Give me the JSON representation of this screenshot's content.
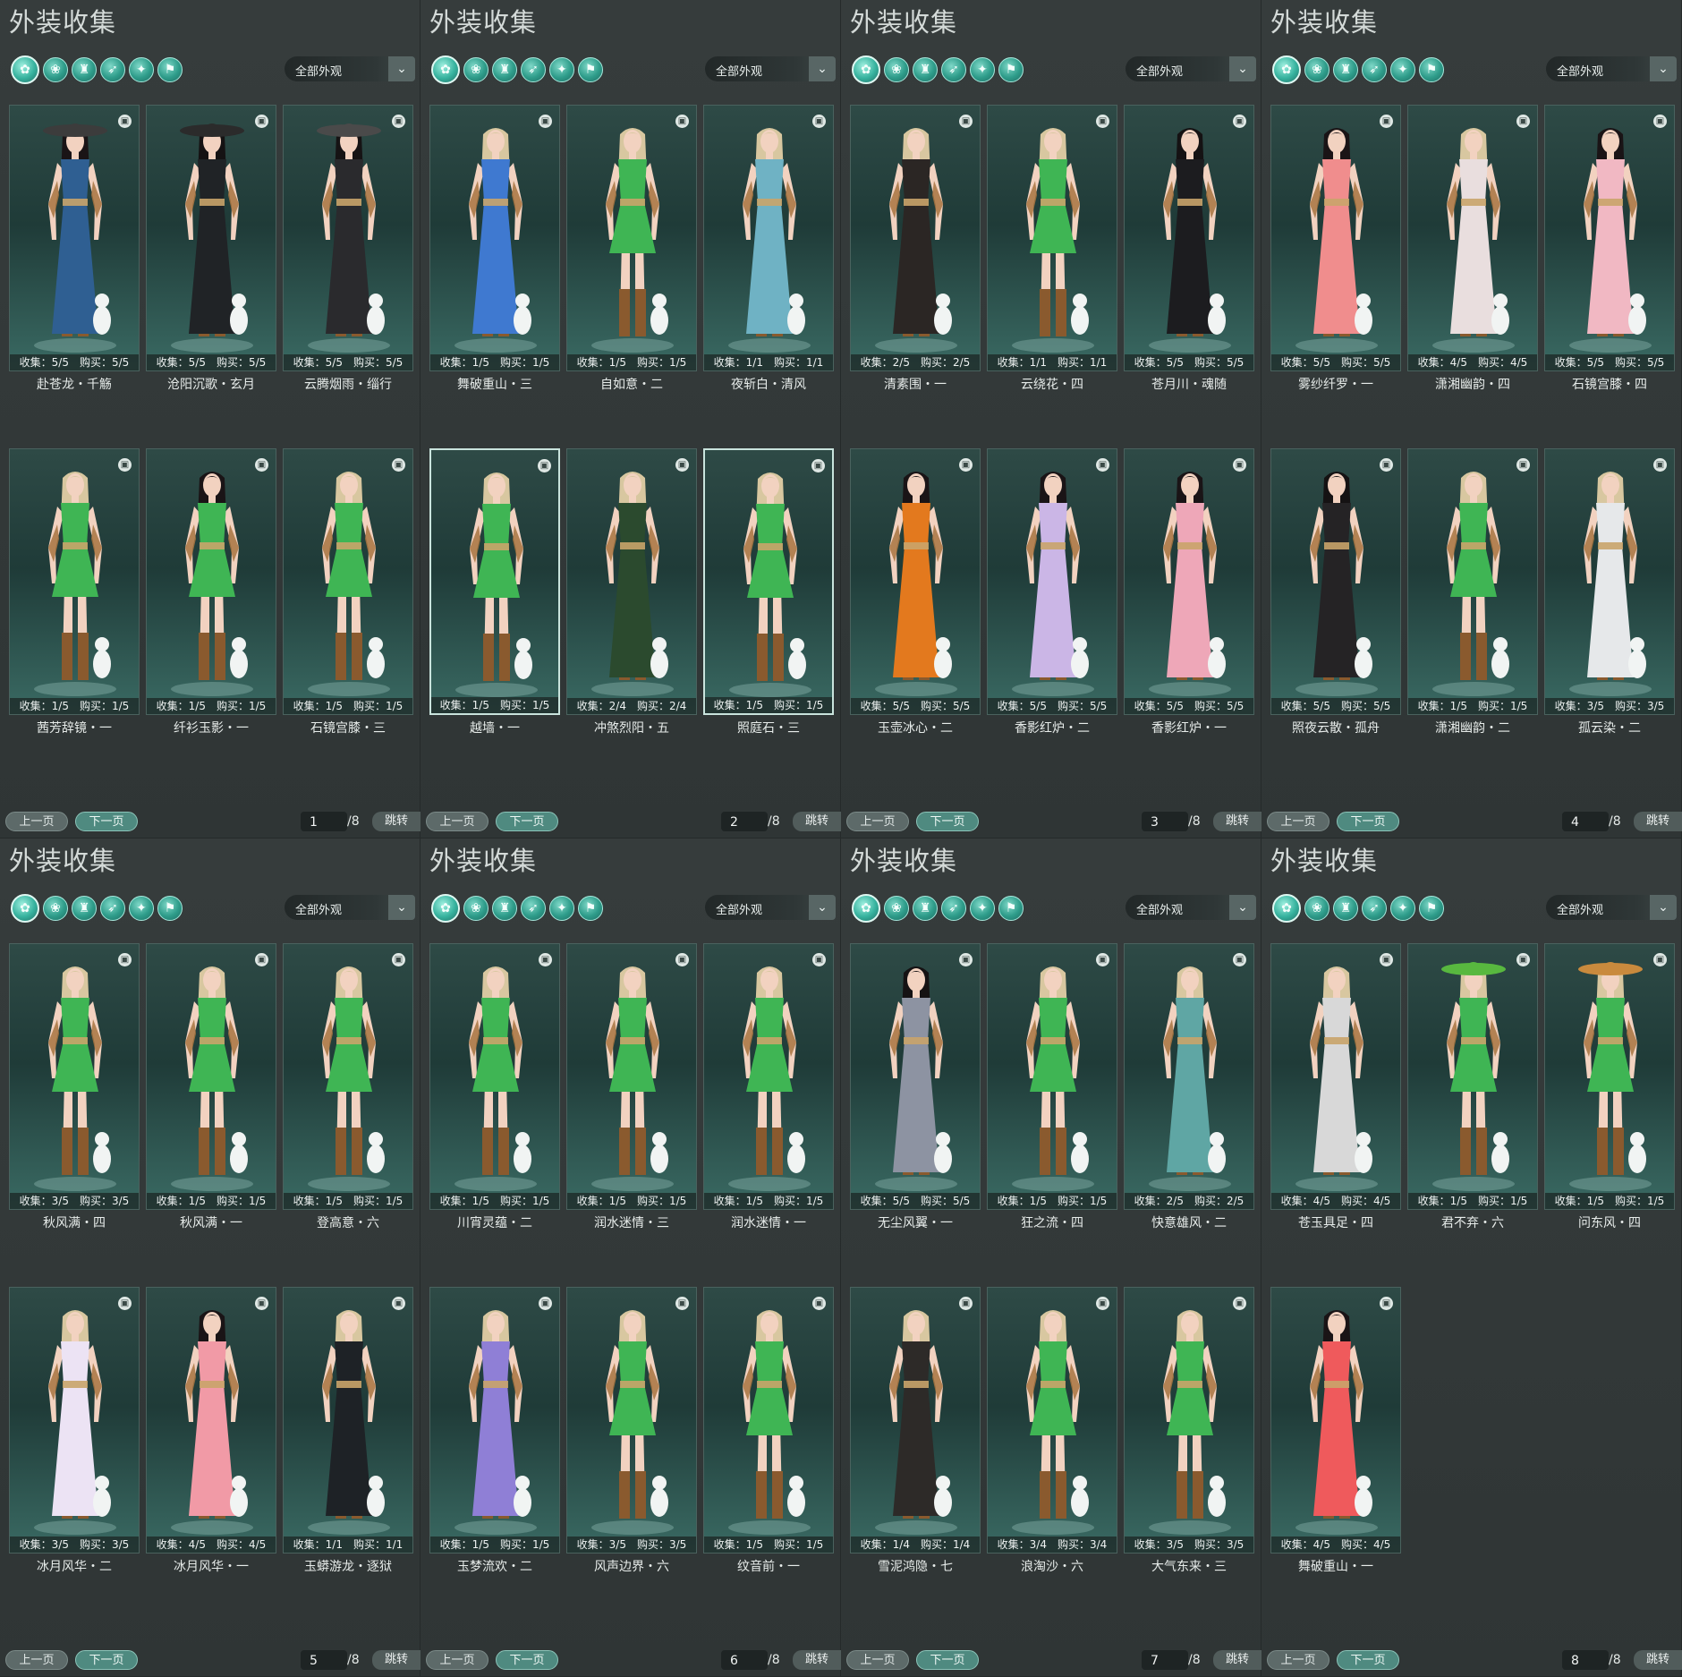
{
  "colors": {
    "background": "#2e3434",
    "card_gradient_top": "#2e4a46",
    "card_gradient_bottom": "#3a6a63",
    "accent_teal": "#2e9c8a",
    "dress_green": "#3fb554"
  },
  "category_icons": [
    "outfit-all-icon",
    "headwear-icon",
    "top-icon",
    "cape-icon",
    "mask-icon",
    "boots-icon"
  ],
  "panels": [
    {
      "title": "外装收集",
      "filter_label": "全部外观",
      "pager": {
        "prev_label": "上一页",
        "next_label": "下一页",
        "current_page": "1",
        "total_label": "/8",
        "jump_label": "跳转"
      },
      "items": [
        {
          "name": "赴苍龙・千觞",
          "stats": "收集：5/5　购买：5/5",
          "outfit": "#2f5f92",
          "hair": "#1a1416",
          "hat": "#3c3c3c"
        },
        {
          "name": "沧阳沉歌・玄月",
          "stats": "收集：5/5　购买：5/5",
          "outfit": "#202326",
          "hair": "#151213",
          "hat": "#2b2b2b"
        },
        {
          "name": "云腾烟雨・缁行",
          "stats": "收集：5/5　购买：5/5",
          "outfit": "#2a2a2d",
          "hair": "#161314",
          "hat": "#4a4a4a"
        },
        {
          "name": "茜芳辞镜・一",
          "stats": "收集：1/5　购买：1/5",
          "outfit": "#3fb554",
          "hair": "#d8c7a0"
        },
        {
          "name": "纤衫玉影・一",
          "stats": "收集：1/5　购买：1/5",
          "outfit": "#3fb554",
          "hair": "#1a1416"
        },
        {
          "name": "石镜宫膝・三",
          "stats": "收集：1/5　购买：1/5",
          "outfit": "#3fb554",
          "hair": "#d8c7a0"
        }
      ]
    },
    {
      "title": "外装收集",
      "filter_label": "全部外观",
      "pager": {
        "prev_label": "上一页",
        "next_label": "下一页",
        "current_page": "2",
        "total_label": "/8",
        "jump_label": "跳转"
      },
      "items": [
        {
          "name": "舞破重山・三",
          "stats": "收集：1/5　购买：1/5",
          "outfit": "#3f79d0",
          "hair": "#d8c7a0"
        },
        {
          "name": "自如意・二",
          "stats": "收集：1/5　购买：1/5",
          "outfit": "#3fb554",
          "hair": "#d8c7a0"
        },
        {
          "name": "夜斩白・清风",
          "stats": "收集：1/1　购买：1/1",
          "outfit": "#6fb2c4",
          "hair": "#d8c7a0"
        },
        {
          "name": "越墙・一",
          "stats": "收集：1/5　购买：1/5",
          "outfit": "#3fb554",
          "hair": "#d8c7a0",
          "selected": true
        },
        {
          "name": "冲煞烈阳・五",
          "stats": "收集：2/4　购买：2/4",
          "outfit": "#2b4a2e",
          "hair": "#d8c7a0"
        },
        {
          "name": "照庭石・三",
          "stats": "收集：1/5　购买：1/5",
          "outfit": "#3fb554",
          "hair": "#d8c7a0",
          "selected": true
        }
      ]
    },
    {
      "title": "外装收集",
      "filter_label": "全部外观",
      "pager": {
        "prev_label": "上一页",
        "next_label": "下一页",
        "current_page": "3",
        "total_label": "/8",
        "jump_label": "跳转"
      },
      "items": [
        {
          "name": "清素围・一",
          "stats": "收集：2/5　购买：2/5",
          "outfit": "#2b2624",
          "hair": "#d8c7a0"
        },
        {
          "name": "云绕花・四",
          "stats": "收集：1/1　购买：1/1",
          "outfit": "#3fb554",
          "hair": "#d8c7a0"
        },
        {
          "name": "苍月川・魂随",
          "stats": "收集：5/5　购买：5/5",
          "outfit": "#1c1c1f",
          "hair": "#151213"
        },
        {
          "name": "玉壶冰心・二",
          "stats": "收集：5/5　购买：5/5",
          "outfit": "#e3791e",
          "hair": "#1a1416"
        },
        {
          "name": "香影红炉・二",
          "stats": "收集：5/5　购买：5/5",
          "outfit": "#cbb6e6",
          "hair": "#1a1416"
        },
        {
          "name": "香影红炉・一",
          "stats": "收集：5/5　购买：5/5",
          "outfit": "#eea7b8",
          "hair": "#1a1416"
        }
      ]
    },
    {
      "title": "外装收集",
      "filter_label": "全部外观",
      "pager": {
        "prev_label": "上一页",
        "next_label": "下一页",
        "current_page": "4",
        "total_label": "/8",
        "jump_label": "跳转"
      },
      "items": [
        {
          "name": "雾纱纤罗・一",
          "stats": "收集：5/5　购买：5/5",
          "outfit": "#f08d8d",
          "hair": "#1a1416"
        },
        {
          "name": "潇湘幽韵・四",
          "stats": "收集：4/5　购买：4/5",
          "outfit": "#e9dede",
          "hair": "#d8c7a0"
        },
        {
          "name": "石镜宫膝・四",
          "stats": "收集：5/5　购买：5/5",
          "outfit": "#f1b8c3",
          "hair": "#1a1416"
        },
        {
          "name": "照夜云散・孤舟",
          "stats": "收集：5/5　购买：5/5",
          "outfit": "#252325",
          "hair": "#151213"
        },
        {
          "name": "潇湘幽韵・二",
          "stats": "收集：1/5　购买：1/5",
          "outfit": "#3fb554",
          "hair": "#d8c7a0"
        },
        {
          "name": "孤云染・二",
          "stats": "收集：3/5　购买：3/5",
          "outfit": "#e6e8ea",
          "hair": "#d8c7a0"
        }
      ]
    },
    {
      "title": "外装收集",
      "filter_label": "全部外观",
      "pager": {
        "prev_label": "上一页",
        "next_label": "下一页",
        "current_page": "5",
        "total_label": "/8",
        "jump_label": "跳转"
      },
      "items": [
        {
          "name": "秋风满・四",
          "stats": "收集：3/5　购买：3/5",
          "outfit": "#3fb554",
          "hair": "#d8c7a0"
        },
        {
          "name": "秋风满・一",
          "stats": "收集：1/5　购买：1/5",
          "outfit": "#3fb554",
          "hair": "#d8c7a0"
        },
        {
          "name": "登高意・六",
          "stats": "收集：1/5　购买：1/5",
          "outfit": "#3fb554",
          "hair": "#d8c7a0"
        },
        {
          "name": "冰月风华・二",
          "stats": "收集：3/5　购买：3/5",
          "outfit": "#ece3f4",
          "hair": "#d8c7a0"
        },
        {
          "name": "冰月风华・一",
          "stats": "收集：4/5　购买：4/5",
          "outfit": "#f19aa6",
          "hair": "#1a1416"
        },
        {
          "name": "玉蟒游龙・逐狱",
          "stats": "收集：1/1　购买：1/1",
          "outfit": "#1e2226",
          "hair": "#d8c7a0"
        }
      ]
    },
    {
      "title": "外装收集",
      "filter_label": "全部外观",
      "pager": {
        "prev_label": "上一页",
        "next_label": "下一页",
        "current_page": "6",
        "total_label": "/8",
        "jump_label": "跳转"
      },
      "items": [
        {
          "name": "川宵灵蕴・二",
          "stats": "收集：1/5　购买：1/5",
          "outfit": "#3fb554",
          "hair": "#d8c7a0"
        },
        {
          "name": "润水迷情・三",
          "stats": "收集：1/5　购买：1/5",
          "outfit": "#3fb554",
          "hair": "#d8c7a0"
        },
        {
          "name": "润水迷情・一",
          "stats": "收集：1/5　购买：1/5",
          "outfit": "#3fb554",
          "hair": "#d8c7a0"
        },
        {
          "name": "玉梦流欢・二",
          "stats": "收集：1/5　购买：1/5",
          "outfit": "#8f7fd6",
          "hair": "#d8c7a0"
        },
        {
          "name": "风声边界・六",
          "stats": "收集：3/5　购买：3/5",
          "outfit": "#3fb554",
          "hair": "#d8c7a0"
        },
        {
          "name": "纹音前・一",
          "stats": "收集：1/5　购买：1/5",
          "outfit": "#3fb554",
          "hair": "#d8c7a0"
        }
      ]
    },
    {
      "title": "外装收集",
      "filter_label": "全部外观",
      "pager": {
        "prev_label": "上一页",
        "next_label": "下一页",
        "current_page": "7",
        "total_label": "/8",
        "jump_label": "跳转"
      },
      "items": [
        {
          "name": "无尘风翼・一",
          "stats": "收集：5/5　购买：5/5",
          "outfit": "#8d93a2",
          "hair": "#151213"
        },
        {
          "name": "狂之流・四",
          "stats": "收集：1/5　购买：1/5",
          "outfit": "#3fb554",
          "hair": "#d8c7a0"
        },
        {
          "name": "快意雄风・二",
          "stats": "收集：2/5　购买：2/5",
          "outfit": "#5fa6a4",
          "hair": "#d8c7a0"
        },
        {
          "name": "雪泥鸿隐・七",
          "stats": "收集：1/4　购买：1/4",
          "outfit": "#2d2a28",
          "hair": "#d8c7a0"
        },
        {
          "name": "浪淘沙・六",
          "stats": "收集：3/4　购买：3/4",
          "outfit": "#3fb554",
          "hair": "#d8c7a0"
        },
        {
          "name": "大气东来・三",
          "stats": "收集：3/5　购买：3/5",
          "outfit": "#3fb554",
          "hair": "#d8c7a0"
        }
      ]
    },
    {
      "title": "外装收集",
      "filter_label": "全部外观",
      "pager": {
        "prev_label": "上一页",
        "next_label": "下一页",
        "current_page": "8",
        "total_label": "/8",
        "jump_label": "跳转"
      },
      "items": [
        {
          "name": "苍玉具足・四",
          "stats": "收集：4/5　购买：4/5",
          "outfit": "#d8d8d8",
          "hair": "#d8c7a0"
        },
        {
          "name": "君不弃・六",
          "stats": "收集：1/5　购买：1/5",
          "outfit": "#3fb554",
          "hair": "#d8c7a0",
          "hat": "#58b83f"
        },
        {
          "name": "问东风・四",
          "stats": "收集：1/5　购买：1/5",
          "outfit": "#3fb554",
          "hair": "#d8c7a0",
          "hat": "#c98a3d"
        },
        {
          "name": "舞破重山・一",
          "stats": "收集：4/5　购买：4/5",
          "outfit": "#ef5a5c",
          "hair": "#1a1416"
        }
      ]
    }
  ]
}
